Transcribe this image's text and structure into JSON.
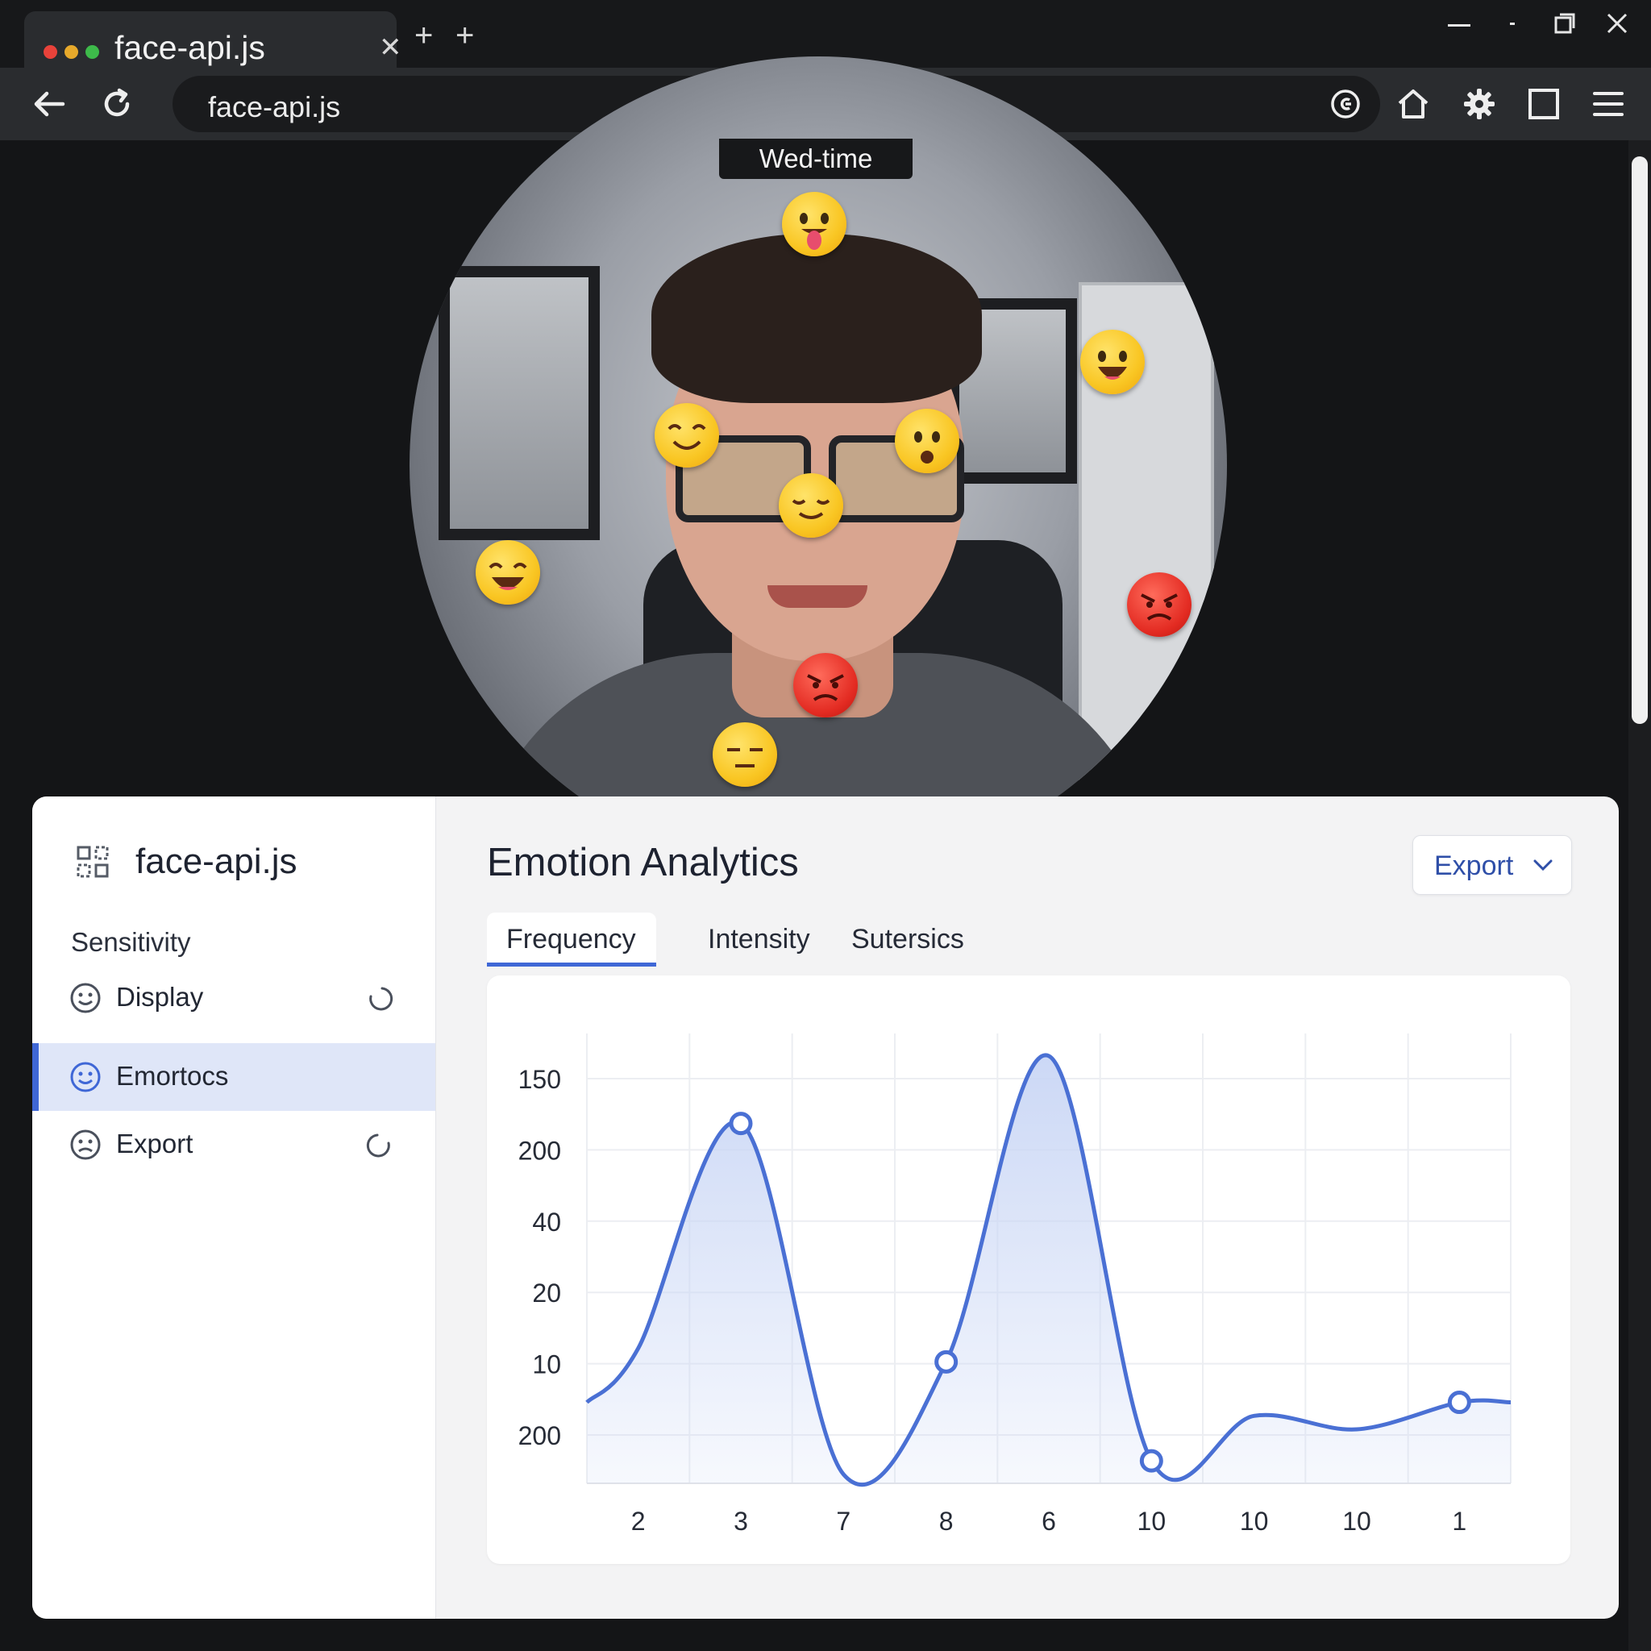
{
  "browser": {
    "tab_title": "face-api.js",
    "url": "face-api.js",
    "new_tab_symbols": [
      "+",
      "+"
    ],
    "window_controls": [
      "minimize",
      "restore",
      "maximize",
      "close"
    ]
  },
  "camera": {
    "label": "Wed-time",
    "emojis": [
      "tongue-out",
      "grinning",
      "smiling",
      "worried",
      "relieved",
      "grinning-big",
      "angry",
      "angry",
      "expressionless"
    ]
  },
  "sidebar": {
    "brand": "face-api.js",
    "heading": "Sensitivity",
    "items": [
      {
        "label": "Display",
        "icon": "smile-icon",
        "active": false,
        "spinner": true
      },
      {
        "label": "Emortocs",
        "icon": "smile-icon",
        "active": true,
        "spinner": false
      },
      {
        "label": "Export",
        "icon": "frown-icon",
        "active": false,
        "spinner": true
      }
    ]
  },
  "main": {
    "title": "Emotion Analytics",
    "export_label": "Export",
    "tabs": [
      {
        "label": "Frequency",
        "active": true
      },
      {
        "label": "Intensity",
        "active": false
      },
      {
        "label": "Sutersics",
        "active": false
      }
    ]
  },
  "colors": {
    "accent": "#3f67d6",
    "line": "#4a70d4",
    "fill": "#c9d6f5"
  },
  "chart_data": {
    "type": "area",
    "title": "",
    "xlabel": "",
    "ylabel": "",
    "x": [
      "2",
      "3",
      "7",
      "8",
      "6",
      "10",
      "10",
      "10",
      "1"
    ],
    "y_tick_labels": [
      "150",
      "200",
      "40",
      "20",
      "10",
      "200"
    ],
    "note_marker_indices": [
      1,
      3,
      5,
      8
    ],
    "series": [
      {
        "values": [
          0.3,
          0.8,
          0.02,
          0.27,
          0.95,
          0.05,
          0.15,
          0.12,
          0.18
        ]
      }
    ],
    "grid": true,
    "legend": "none"
  }
}
